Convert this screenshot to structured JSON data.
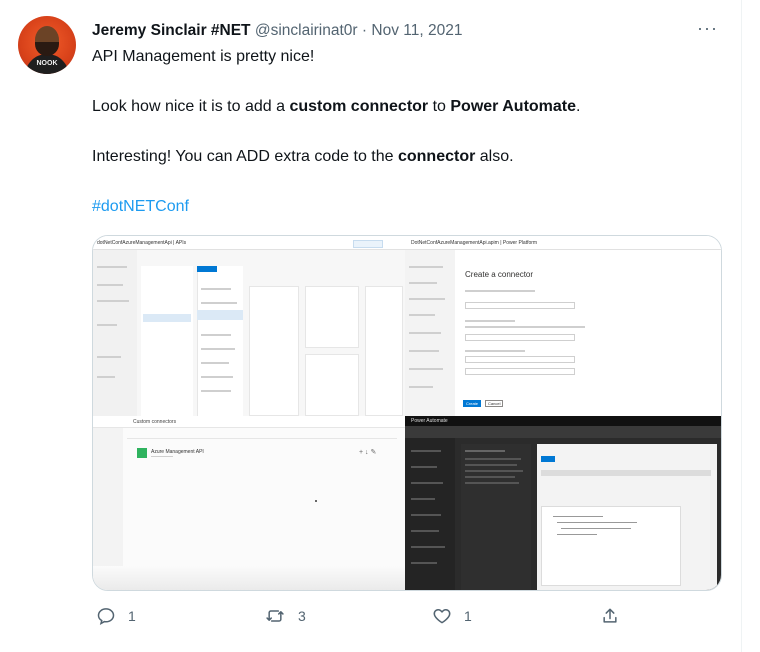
{
  "tweet": {
    "author_name": "Jeremy Sinclair #NET",
    "handle": "@sinclairinat0r",
    "separator": "·",
    "date": "Nov 11, 2021",
    "more_label": "···",
    "avatar_text": "NOOK",
    "line1": "API Management is pretty nice!",
    "line2_a": "Look how nice it is to add a ",
    "line2_b": "custom connector",
    "line2_c": " to ",
    "line2_d": "Power Automate",
    "line2_e": ".",
    "line3_a": "Interesting! You can ADD extra code to the ",
    "line3_b": "connector",
    "line3_c": " also.",
    "hashtag": "#dotNETConf"
  },
  "media": {
    "tl_title": "dotNetConfAzureManagementApi | APIs",
    "tr_title": "DotNetConfAzureManagementApi.apim | Power Platform",
    "tr_heading": "Create a connector",
    "tr_create_btn": "Create",
    "tr_cancel_btn": "Cancel",
    "bl_title": "Custom connectors",
    "bl_item": "Azure Management API",
    "br_title": "Power Automate"
  },
  "actions": {
    "reply_count": "1",
    "retweet_count": "3",
    "like_count": "1"
  },
  "colors": {
    "link": "#1d9bf0",
    "muted": "#536471",
    "azure_blue": "#0078d4",
    "connector_green": "#2fb35f"
  }
}
